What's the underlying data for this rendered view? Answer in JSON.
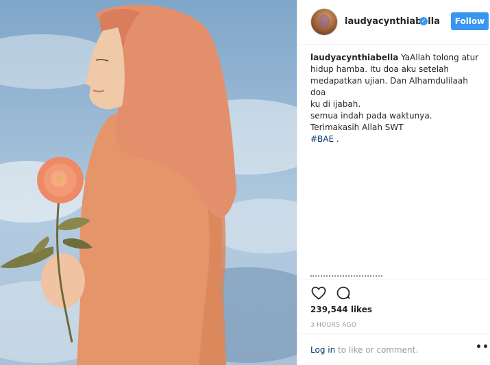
{
  "post": {
    "username": "laudyacynthiabella",
    "verified_icon": "verified-badge-icon",
    "follow_label": "Follow",
    "caption": {
      "username": "laudyacynthiabella",
      "lines": [
        "YaAllah tolong atur",
        "hidup hamba. Itu doa aku setelah",
        "medapatkan ujian. Dan Alhamdulilaah doa",
        "ku di ijabah.",
        "semua indah pada waktunya.",
        "Terimakasih Allah SWT"
      ],
      "hashtag": "#BAE",
      "hashtag_suffix": " ."
    },
    "actions": {
      "like_icon": "heart-icon",
      "comment_icon": "comment-icon"
    },
    "likes": "239,544 likes",
    "time": "3 HOURS AGO",
    "footer": {
      "login_label": "Log in",
      "rest": " to like or comment.",
      "more_icon": "more-options-icon",
      "more_glyph": "•••"
    },
    "colors": {
      "accent": "#3897f0",
      "link": "#003569",
      "muted": "#999999"
    }
  }
}
